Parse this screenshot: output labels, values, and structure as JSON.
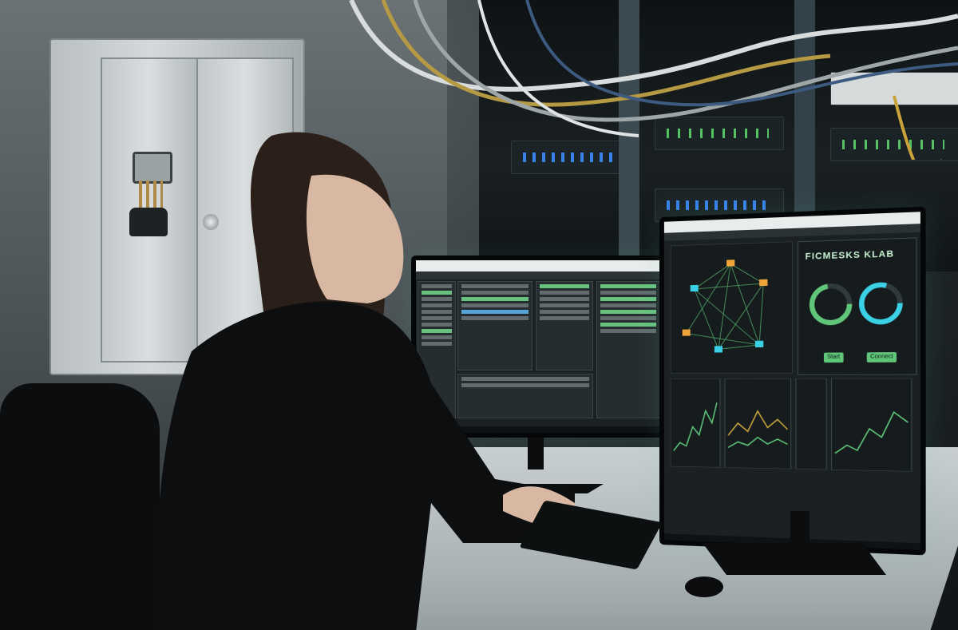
{
  "scene": {
    "description_tags": [
      "server-room",
      "workstation",
      "dual-monitor",
      "network-dashboard"
    ]
  },
  "right_monitor": {
    "dashboard_title": "FICMESKS KLAB",
    "button_labels": [
      "Start",
      "Connect"
    ]
  },
  "colors": {
    "accent_green": "#5fc679",
    "accent_cyan": "#3ad0e6",
    "led_blue": "#3b8cff",
    "led_green": "#5bd46a",
    "orange_node": "#f0a53a"
  },
  "icons": [
    "key-icon",
    "padlock-icon",
    "server-led-icon",
    "gauge-icon",
    "chart-icon"
  ]
}
